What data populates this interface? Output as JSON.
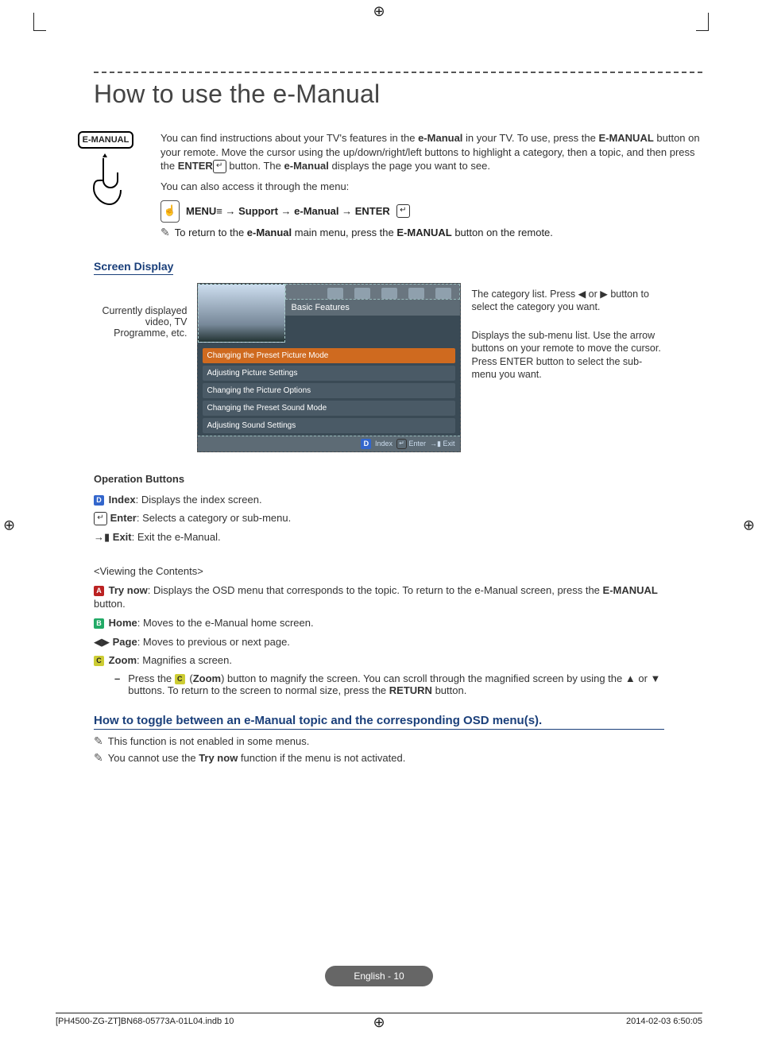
{
  "title": "How to use the e-Manual",
  "remote_button_label": "E-MANUAL",
  "intro": {
    "p1_a": "You can find instructions about your TV's features in the ",
    "p1_b": "e-Manual",
    "p1_c": " in your TV. To use, press the ",
    "p1_d": "E-MANUAL",
    "p1_e": " button on your remote. Move the cursor using the up/down/right/left buttons to highlight a category, then a topic, and then press the ",
    "p1_f": "ENTER",
    "p1_g": " button. The ",
    "p1_h": "e-Manual",
    "p1_i": " displays the page you want to see.",
    "p2": "You can also access it through the menu:",
    "menu_path": "MENU≡ → Support → e-Manual → ENTER",
    "note1_a": "To return to the ",
    "note1_b": "e-Manual",
    "note1_c": " main menu, press the ",
    "note1_d": "E-MANUAL",
    "note1_e": " button on the remote."
  },
  "screen_display_head": "Screen Display",
  "screen_left": "Currently displayed video, TV Programme, etc.",
  "screen": {
    "cat_label": "Basic Features",
    "items": [
      "Changing the Preset Picture Mode",
      "Adjusting Picture Settings",
      "Changing the Picture Options",
      "Changing the Preset Sound Mode",
      "Adjusting Sound Settings"
    ],
    "footer_index": "Index",
    "footer_enter": "Enter",
    "footer_exit": "Exit"
  },
  "screen_right": {
    "r1": "The category list. Press ◀ or ▶ button to select the category you want.",
    "r2": "Displays the sub-menu list. Use the arrow buttons on your remote to move the cursor. Press ENTER button to select the sub-menu you want."
  },
  "ops_head": "Operation Buttons",
  "ops": {
    "index_label": "Index",
    "index_desc": ": Displays the index screen.",
    "enter_label": "Enter",
    "enter_desc": ": Selects a category or sub-menu.",
    "exit_label": "Exit",
    "exit_desc": ": Exit the e-Manual."
  },
  "viewing_head": "<Viewing the Contents>",
  "viewing": {
    "try_label": "Try now",
    "try_desc": ": Displays the OSD menu that corresponds to the topic. To return to the e-Manual screen, press the ",
    "try_tail": " button.",
    "emanual": "E-MANUAL",
    "home_label": "Home",
    "home_desc": ": Moves to the e-Manual home screen.",
    "page_label": "Page",
    "page_desc": ": Moves to previous or next page.",
    "zoom_label": "Zoom",
    "zoom_desc": ": Magnifies a screen.",
    "zoom_sub_a": "Press the ",
    "zoom_sub_b": " (",
    "zoom_sub_c": "Zoom",
    "zoom_sub_d": ") button to magnify the screen. You can scroll through the magnified screen by using the ▲ or ▼ buttons. To return to the screen to normal size, press the ",
    "zoom_sub_e": "RETURN",
    "zoom_sub_f": " button."
  },
  "toggle_head": "How to toggle between an e-Manual topic and the corresponding OSD menu(s).",
  "toggle_n1": "This function is not enabled in some menus.",
  "toggle_n2_a": "You cannot use the ",
  "toggle_n2_b": "Try now",
  "toggle_n2_c": " function if the menu is not activated.",
  "footer_pill": "English - 10",
  "footer_left": "[PH4500-ZG-ZT]BN68-05773A-01L04.indb   10",
  "footer_right": "2014-02-03   6:50:05"
}
